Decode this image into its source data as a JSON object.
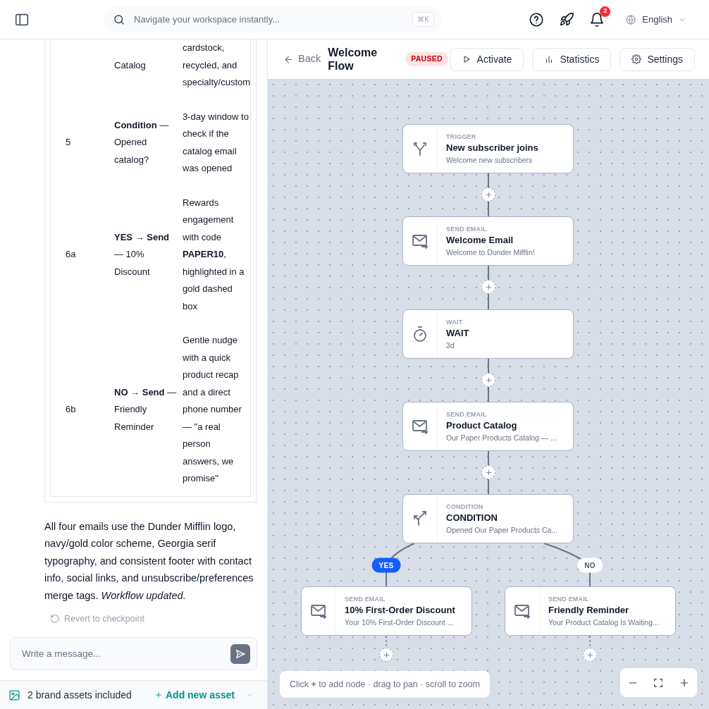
{
  "header": {
    "search": {
      "placeholder": "Navigate your workspace instantly...",
      "shortcut": "⌘K"
    },
    "notifications": {
      "count": "2"
    },
    "language": "English"
  },
  "chat": {
    "table": {
      "rows": [
        {
          "column_1": "",
          "column_2": "Catalog",
          "column_3": "cardstock, recycled, and specialty/custom"
        },
        {
          "column_1": "5",
          "column_2": "**Condition** — Opened catalog?",
          "column_3": "3-day window to check if the catalog email was opened"
        },
        {
          "column_1": "6a",
          "column_2": "**YES → Send** — 10% Discount",
          "column_3": "Rewards engagement with code **PAPER10**, highlighted in a gold dashed box"
        },
        {
          "column_1": "6b",
          "column_2": "**NO → Send** — Friendly Reminder",
          "column_3": "Gentle nudge with a quick product recap and a direct phone number — \"a real person answers, we promise\""
        }
      ]
    },
    "message": "All four emails use the Dunder Mifflin logo, navy/gold color scheme, Georgia serif typography, and consistent footer with contact info, social links, and unsubscribe/preferences merge tags. *Workflow updated.*",
    "revert": "Revert to checkpoint",
    "input": {
      "placeholder": "Write a message..."
    },
    "assets": {
      "label": "2 brand assets included",
      "add": "Add new asset"
    }
  },
  "toolbar": {
    "back": "Back",
    "title": "Welcome Flow",
    "status": "PAUSED",
    "buttons": [
      {
        "kind": "activate",
        "label": "Activate"
      },
      {
        "kind": "statistics",
        "label": "Statistics"
      },
      {
        "kind": "settings",
        "label": "Settings"
      }
    ]
  },
  "flow": {
    "nodes": [
      {
        "kind": "trigger",
        "type": "TRIGGER",
        "title": "New subscriber joins",
        "subtitle": "Welcome new subscribers"
      },
      {
        "kind": "email",
        "type": "SEND EMAIL",
        "title": "Welcome Email",
        "subtitle": "Welcome to Dunder Mifflin!"
      },
      {
        "kind": "wait",
        "type": "WAIT",
        "title": "WAIT",
        "subtitle": "3d"
      },
      {
        "kind": "email",
        "type": "SEND EMAIL",
        "title": "Product Catalog",
        "subtitle": "Our Paper Products Catalog — ..."
      },
      {
        "kind": "condition",
        "type": "CONDITION",
        "title": "CONDITION",
        "subtitle": "Opened Our Paper Products Ca..."
      }
    ],
    "branches": [
      {
        "kind": "yes",
        "label": "YES",
        "node": {
          "kind": "email",
          "type": "SEND EMAIL",
          "title": "10% First-Order Discount",
          "subtitle": "Your 10% First-Order Discount ..."
        }
      },
      {
        "kind": "no",
        "label": "NO",
        "node": {
          "kind": "email",
          "type": "SEND EMAIL",
          "title": "Friendly Reminder",
          "subtitle": "Your Product Catalog Is Waiting..."
        }
      }
    ],
    "hint": "Click **+** to add node · drag to pan · scroll to zoom"
  }
}
